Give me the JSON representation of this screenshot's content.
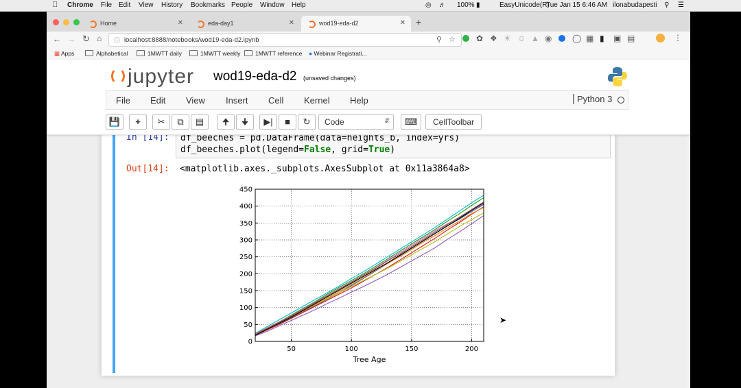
{
  "menubar": {
    "app": "Chrome",
    "items": [
      "File",
      "Edit",
      "View",
      "History",
      "Bookmarks",
      "People",
      "Window",
      "Help"
    ],
    "battery": "100%",
    "input_source": "EasyUnicode(R)",
    "clock": "Tue Jan 15  6:46 AM",
    "user": "ilonabudapesti"
  },
  "browser": {
    "tabs": [
      {
        "label": "Home"
      },
      {
        "label": "eda-day1"
      },
      {
        "label": "wod19-eda-d2"
      }
    ],
    "url": "localhost:8888/notebooks/wod19-eda-d2.ipynb",
    "bookmarks": [
      "Apps",
      "Alphabetical",
      "1MWTT daily",
      "1MWTT weekly",
      "1MWTT reference",
      "Webinar Registrati..."
    ]
  },
  "jupyter": {
    "logo": "jupyter",
    "notebook_title": "wod19-eda-d2",
    "save_status": "(unsaved changes)",
    "menu": [
      "File",
      "Edit",
      "View",
      "Insert",
      "Cell",
      "Kernel",
      "Help"
    ],
    "kernel": "Python 3",
    "cell_type": "Code",
    "celltoolbar": "CellToolbar"
  },
  "cell": {
    "in_prompt": "In [14]:",
    "code_line1_a": "df_beeches = pd.DataFrame(data=heights_b, index=yrs)",
    "code_line2_a": "df_beeches.plot(legend=",
    "code_line2_kw1": "False",
    "code_line2_b": ", grid=",
    "code_line2_kw2": "True",
    "code_line2_c": ")",
    "out_prompt": "Out[14]:",
    "out_text": "<matplotlib.axes._subplots.AxesSubplot at 0x11a3864a8>"
  },
  "chart_data": {
    "type": "line",
    "xlabel": "Tree Age",
    "ylabel": "",
    "xlim": [
      20,
      210
    ],
    "ylim": [
      0,
      450
    ],
    "xticks": [
      50,
      100,
      150,
      200
    ],
    "yticks": [
      0,
      50,
      100,
      150,
      200,
      250,
      300,
      350,
      400,
      450
    ],
    "grid": true,
    "legend": false,
    "x": [
      20,
      30,
      40,
      50,
      60,
      70,
      80,
      90,
      100,
      110,
      120,
      130,
      140,
      150,
      160,
      170,
      180,
      190,
      200,
      210
    ],
    "series": [
      {
        "color": "#1f77b4",
        "values": [
          20,
          36,
          52,
          70,
          88,
          106,
          125,
          144,
          165,
          186,
          208,
          230,
          252,
          276,
          298,
          320,
          342,
          362,
          384,
          405
        ]
      },
      {
        "color": "#2ca02c",
        "values": [
          22,
          40,
          58,
          78,
          98,
          118,
          140,
          160,
          180,
          200,
          222,
          244,
          266,
          288,
          310,
          332,
          356,
          378,
          402,
          425
        ]
      },
      {
        "color": "#d62728",
        "values": [
          18,
          34,
          50,
          68,
          86,
          104,
          122,
          140,
          158,
          178,
          198,
          218,
          240,
          262,
          284,
          306,
          330,
          352,
          376,
          398
        ]
      },
      {
        "color": "#17becf",
        "values": [
          24,
          44,
          64,
          84,
          104,
          124,
          144,
          164,
          186,
          206,
          228,
          250,
          272,
          294,
          316,
          338,
          362,
          386,
          410,
          432
        ]
      },
      {
        "color": "#9467bd",
        "values": [
          16,
          30,
          46,
          62,
          78,
          94,
          112,
          128,
          146,
          162,
          180,
          198,
          218,
          238,
          258,
          278,
          302,
          324,
          348,
          372
        ]
      },
      {
        "color": "#bcbd22",
        "values": [
          20,
          38,
          56,
          74,
          92,
          108,
          126,
          144,
          162,
          180,
          198,
          216,
          236,
          256,
          276,
          296,
          318,
          340,
          360,
          380
        ]
      },
      {
        "color": "#e377c2",
        "values": [
          22,
          40,
          58,
          76,
          96,
          116,
          136,
          156,
          176,
          196,
          218,
          240,
          262,
          284,
          306,
          328,
          348,
          366,
          386,
          408
        ]
      },
      {
        "color": "#ff7f0e",
        "values": [
          20,
          36,
          54,
          72,
          90,
          110,
          128,
          148,
          168,
          188,
          210,
          230,
          250,
          272,
          294,
          314,
          336,
          356,
          378,
          396
        ]
      },
      {
        "color": "#000000",
        "values": [
          18,
          36,
          54,
          72,
          92,
          112,
          132,
          152,
          172,
          192,
          212,
          232,
          254,
          276,
          298,
          320,
          342,
          364,
          388,
          410
        ]
      },
      {
        "color": "#8c564b",
        "values": [
          21,
          39,
          57,
          75,
          95,
          115,
          135,
          155,
          175,
          196,
          216,
          238,
          258,
          280,
          302,
          324,
          346,
          368,
          390,
          412
        ]
      }
    ]
  }
}
